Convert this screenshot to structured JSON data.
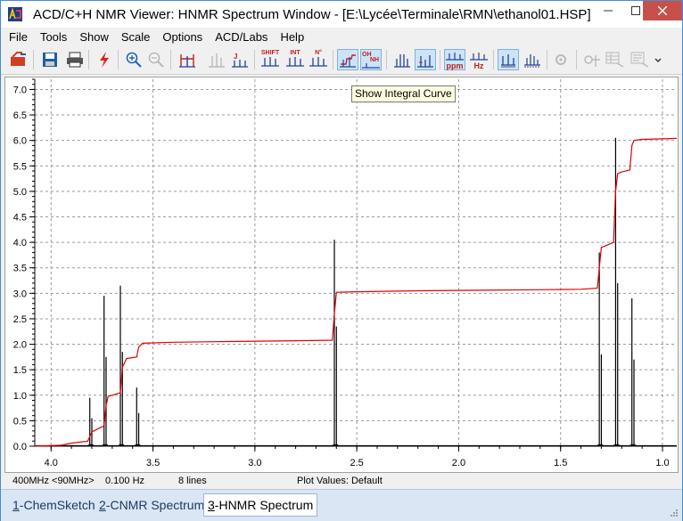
{
  "window": {
    "title": "ACD/C+H NMR Viewer: HNMR Spectrum Window - [E:\\Lycée\\Terminale\\RMN\\ethanol01.HSP]",
    "colors": {
      "accent": "#3d8fd8",
      "close": "#c7504a"
    }
  },
  "menu": {
    "items": [
      {
        "label": "File",
        "name": "menu-file"
      },
      {
        "label": "Tools",
        "name": "menu-tools"
      },
      {
        "label": "Show",
        "name": "menu-show"
      },
      {
        "label": "Scale",
        "name": "menu-scale"
      },
      {
        "label": "Options",
        "name": "menu-options"
      },
      {
        "label": "ACD/Labs",
        "name": "menu-acdlabs"
      },
      {
        "label": "Help",
        "name": "menu-help"
      }
    ]
  },
  "toolbar": {
    "shift_label": "SHIFT",
    "int_label": "INT",
    "nh_label": "N°",
    "oh_label": "OH",
    "oh_sub": "NH",
    "ppm_label": "ppm",
    "hz_label": "Hz"
  },
  "tooltip": {
    "text": "Show Integral Curve"
  },
  "plot": {
    "y_ticks": [
      "0.0",
      "0.5",
      "1.0",
      "1.5",
      "2.0",
      "2.5",
      "3.0",
      "3.5",
      "4.0",
      "4.5",
      "5.0",
      "5.5",
      "6.0",
      "6.5",
      "7.0"
    ],
    "x_ticks": [
      "4.0",
      "3.5",
      "3.0",
      "2.5",
      "2.0",
      "1.5",
      "1.0"
    ],
    "colors": {
      "spectrum": "#000000",
      "integral": "#e00000",
      "grid": "#9a9a9a"
    }
  },
  "chart_data": {
    "type": "line",
    "x_unit": "ppm",
    "xlim": [
      4.08,
      0.93
    ],
    "ylim": [
      0,
      7.2
    ],
    "grid": true,
    "spectrum_peaks": [
      {
        "x": 3.81,
        "height": 0.95
      },
      {
        "x": 3.8,
        "height": 0.55
      },
      {
        "x": 3.74,
        "height": 2.95
      },
      {
        "x": 3.73,
        "height": 1.75
      },
      {
        "x": 3.66,
        "height": 3.15
      },
      {
        "x": 3.65,
        "height": 1.85
      },
      {
        "x": 3.58,
        "height": 1.15
      },
      {
        "x": 3.57,
        "height": 0.65
      },
      {
        "x": 2.61,
        "height": 4.05
      },
      {
        "x": 2.6,
        "height": 2.35
      },
      {
        "x": 1.31,
        "height": 3.8
      },
      {
        "x": 1.3,
        "height": 1.8
      },
      {
        "x": 1.23,
        "height": 6.05
      },
      {
        "x": 1.22,
        "height": 3.2
      },
      {
        "x": 1.15,
        "height": 2.9
      },
      {
        "x": 1.14,
        "height": 1.7
      }
    ],
    "integral_curve": {
      "x": [
        4.08,
        3.95,
        3.9,
        3.82,
        3.8,
        3.79,
        3.74,
        3.73,
        3.72,
        3.7,
        3.66,
        3.65,
        3.63,
        3.58,
        3.57,
        3.55,
        3.4,
        3.2,
        3.0,
        2.8,
        2.62,
        2.61,
        2.6,
        2.5,
        2.2,
        1.9,
        1.6,
        1.4,
        1.32,
        1.31,
        1.3,
        1.28,
        1.24,
        1.23,
        1.22,
        1.2,
        1.16,
        1.15,
        1.14,
        1.1,
        1.0,
        0.93
      ],
      "y": [
        0.0,
        0.02,
        0.06,
        0.1,
        0.28,
        0.3,
        0.4,
        0.8,
        0.98,
        1.0,
        1.05,
        1.55,
        1.72,
        1.75,
        1.95,
        2.02,
        2.04,
        2.05,
        2.06,
        2.07,
        2.08,
        2.6,
        3.02,
        3.03,
        3.05,
        3.06,
        3.07,
        3.08,
        3.1,
        3.5,
        3.9,
        3.93,
        4.0,
        5.0,
        5.35,
        5.38,
        5.42,
        5.9,
        6.0,
        6.02,
        6.03,
        6.04
      ]
    }
  },
  "status": {
    "freq": "400MHz <90MHz>",
    "res": "0.100 Hz",
    "lines": "8 lines",
    "plot_values": "Plot Values: Default"
  },
  "tabs": [
    {
      "num": "1",
      "label": "-ChemSketch",
      "name": "tab-chemsketch",
      "active": false
    },
    {
      "num": "2",
      "label": "-CNMR Spectrum",
      "name": "tab-cnmr-spectrum",
      "active": false
    },
    {
      "num": "3",
      "label": "-HNMR Spectrum",
      "name": "tab-hnmr-spectrum",
      "active": true
    }
  ]
}
